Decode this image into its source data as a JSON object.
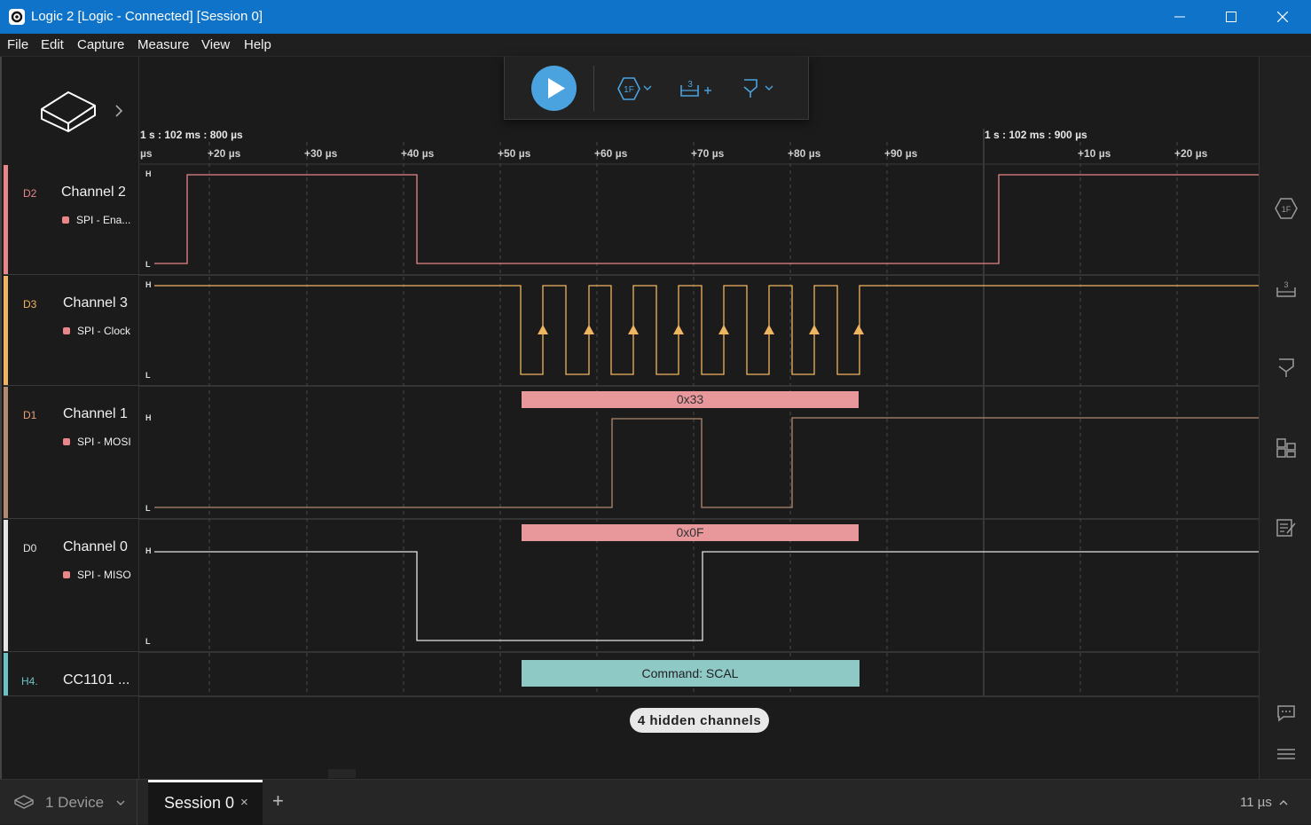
{
  "window": {
    "title": "Logic 2 [Logic - Connected] [Session 0]"
  },
  "menu": [
    "File",
    "Edit",
    "Capture",
    "Measure",
    "View",
    "Help"
  ],
  "timeline": {
    "anchor_left": "1 s : 102 ms : 800 µs",
    "anchor_right": "1 s : 102 ms : 900 µs",
    "ticks_left": [
      "µs",
      "+20 µs",
      "+30 µs",
      "+40 µs",
      "+50 µs",
      "+60 µs",
      "+70 µs",
      "+80 µs",
      "+90 µs"
    ],
    "ticks_right": [
      "+10 µs",
      "+20 µs"
    ]
  },
  "channels": [
    {
      "id": "D2",
      "name": "Channel 2",
      "analyzer": "SPI - Ena...",
      "color": "#e8868a",
      "high": "H",
      "low": "L"
    },
    {
      "id": "D3",
      "name": "Channel 3",
      "analyzer": "SPI - Clock",
      "color": "#f0b560",
      "high": "H",
      "low": "L"
    },
    {
      "id": "D1",
      "name": "Channel 1",
      "analyzer": "SPI - MOSI",
      "color": "#b08a72",
      "high": "H",
      "low": "L"
    },
    {
      "id": "D0",
      "name": "Channel 0",
      "analyzer": "SPI - MISO",
      "color": "#e4e4e4",
      "high": "H",
      "low": "L"
    },
    {
      "id": "H4.",
      "name": "CC1101 ...",
      "color": "#6cc3c4"
    }
  ],
  "decoded": {
    "mosi": "0x33",
    "miso": "0x0F",
    "hla": "Command: SCAL"
  },
  "hidden_channels": "4 hidden channels",
  "statusbar": {
    "device": "1 Device",
    "session_tab": "Session 0",
    "close": "×",
    "add": "+",
    "timescale": "11 µs"
  },
  "toolbar": {
    "trigger_label": "1F",
    "measure_label": "3"
  },
  "rightbar": {
    "trigger_label": "1F",
    "measure_label": "3"
  }
}
